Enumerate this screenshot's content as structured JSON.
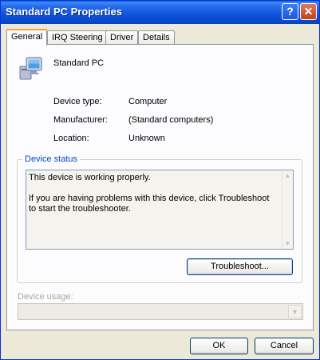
{
  "window": {
    "title": "Standard PC Properties",
    "help_glyph": "?",
    "close_glyph": "✕"
  },
  "tabs": [
    "General",
    "IRQ Steering",
    "Driver",
    "Details"
  ],
  "device": {
    "name": "Standard PC",
    "icon": "computer-icon"
  },
  "properties": [
    {
      "label": "Device type:",
      "value": "Computer"
    },
    {
      "label": "Manufacturer:",
      "value": "(Standard computers)"
    },
    {
      "label": "Location:",
      "value": "Unknown"
    }
  ],
  "status": {
    "legend": "Device status",
    "line1": "This device is working properly.",
    "line2": "If you are having problems with this device, click Troubleshoot to start the troubleshooter.",
    "troubleshoot_label": "Troubleshoot..."
  },
  "usage": {
    "label": "Device usage:",
    "value": ""
  },
  "buttons": {
    "ok": "OK",
    "cancel": "Cancel"
  },
  "colors": {
    "titlebar": "#0a4bcf",
    "dialog_bg": "#ece9d8",
    "active_tab_accent": "#f1a13c",
    "group_legend": "#0046d5"
  }
}
